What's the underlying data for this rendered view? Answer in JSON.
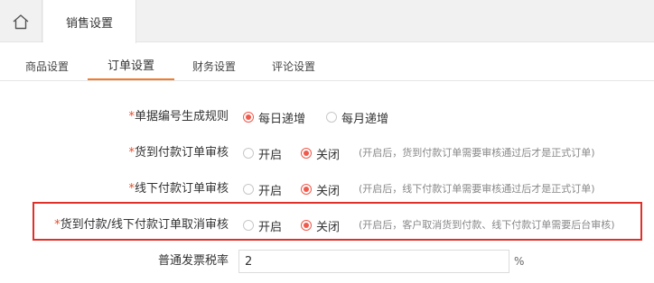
{
  "header": {
    "home_icon": "home-icon",
    "tab_label": "销售设置"
  },
  "subtabs": [
    {
      "label": "商品设置",
      "active": false
    },
    {
      "label": "订单设置",
      "active": true
    },
    {
      "label": "财务设置",
      "active": false
    },
    {
      "label": "评论设置",
      "active": false
    }
  ],
  "form": {
    "numbering": {
      "required_mark": "*",
      "label": "单据编号生成规则",
      "options": [
        {
          "label": "每日递增",
          "selected": true
        },
        {
          "label": "每月递增",
          "selected": false
        }
      ]
    },
    "cod_review": {
      "required_mark": "*",
      "label": "货到付款订单审核",
      "options": [
        {
          "label": "开启",
          "selected": false
        },
        {
          "label": "关闭",
          "selected": true
        }
      ],
      "hint": "(开启后，货到付款订单需要审核通过后才是正式订单)"
    },
    "offline_review": {
      "required_mark": "*",
      "label": "线下付款订单审核",
      "options": [
        {
          "label": "开启",
          "selected": false
        },
        {
          "label": "关闭",
          "selected": true
        }
      ],
      "hint": "(开启后，线下付款订单需要审核通过后才是正式订单)"
    },
    "cancel_review": {
      "required_mark": "*",
      "label": "货到付款/线下付款订单取消审核",
      "options": [
        {
          "label": "开启",
          "selected": false
        },
        {
          "label": "关闭",
          "selected": true
        }
      ],
      "hint": "(开启后，客户取消货到付款、线下付款订单需要后台审核)"
    },
    "tax_rate": {
      "label": "普通发票税率",
      "value": "2",
      "unit": "%"
    }
  },
  "colors": {
    "accent": "#f05a4c",
    "tab_underline": "#f07c2e",
    "highlight_border": "#e0302a",
    "required": "#ee4a22"
  }
}
